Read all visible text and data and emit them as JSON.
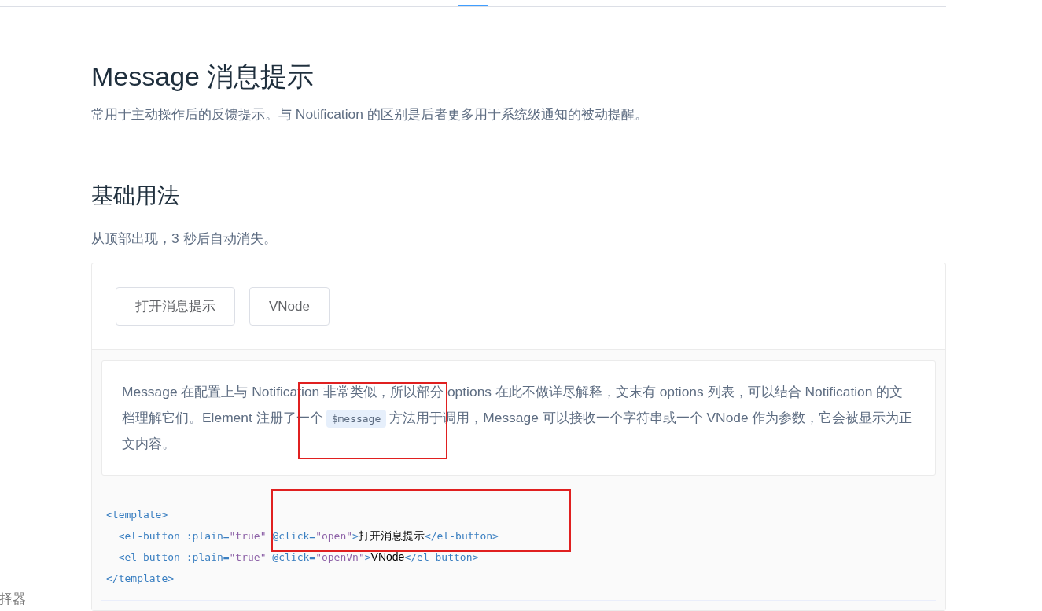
{
  "top_nav": {
    "tabs": [
      {
        "selected": false
      },
      {
        "selected": true
      },
      {
        "selected": false
      }
    ]
  },
  "sidebar": {
    "items": [
      "择器"
    ]
  },
  "title": "Message 消息提示",
  "description": "常用于主动操作后的反馈提示。与 Notification 的区别是后者更多用于系统级通知的被动提醒。",
  "section": {
    "title": "基础用法",
    "description": "从顶部出现，3 秒后自动消失。"
  },
  "demo": {
    "buttons": [
      "打开消息提示",
      "VNode"
    ],
    "note": {
      "before": "Message 在配置上与 Notification 非常类似，所以部分 options 在此不做详尽解释，文末有 options 列表，可以结合 Notification 的文档理解它们。Element 注册了一个",
      "code": "$message",
      "after": "方法用于调用，Message 可以接收一个字符串或一个 VNode 作为参数，它会被显示为正文内容。"
    },
    "code_lines": [
      [
        {
          "kind": "tag",
          "text": "<template>"
        }
      ],
      [
        {
          "kind": "tag",
          "text": "  <el-button "
        },
        {
          "kind": "attr",
          "text": ":plain="
        },
        {
          "kind": "string",
          "text": "\"true\""
        },
        {
          "kind": "attr",
          "text": " @click="
        },
        {
          "kind": "string",
          "text": "\"open\""
        },
        {
          "kind": "tag",
          "text": ">"
        },
        {
          "kind": "text",
          "text": "打开消息提示"
        },
        {
          "kind": "tag",
          "text": "</el-button>"
        }
      ],
      [
        {
          "kind": "tag",
          "text": "  <el-button "
        },
        {
          "kind": "attr",
          "text": ":plain="
        },
        {
          "kind": "string",
          "text": "\"true\""
        },
        {
          "kind": "attr",
          "text": " @click="
        },
        {
          "kind": "string",
          "text": "\"openVn\""
        },
        {
          "kind": "tag",
          "text": ">"
        },
        {
          "kind": "text",
          "text": "VNode"
        },
        {
          "kind": "tag",
          "text": "</el-button>"
        }
      ],
      [
        {
          "kind": "tag",
          "text": "</template>"
        }
      ]
    ]
  },
  "annotations": [
    {
      "kind": "highlight",
      "color": "#e02020"
    },
    {
      "kind": "highlight",
      "color": "#e02020"
    }
  ]
}
